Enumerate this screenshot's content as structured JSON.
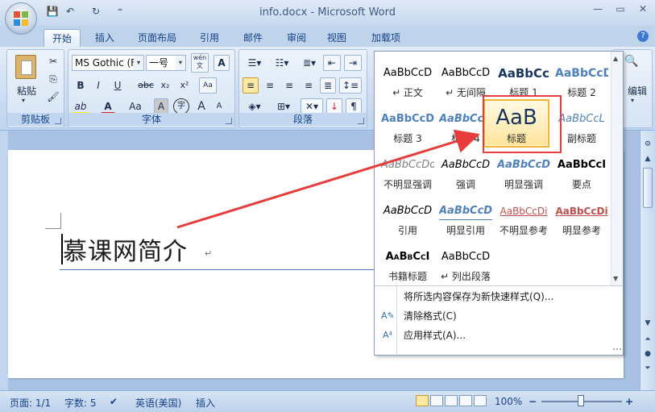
{
  "window": {
    "title": "info.docx - Microsoft Word",
    "controls": {
      "minimize": "—",
      "maximize": "▭",
      "close": "✕"
    }
  },
  "qat": {
    "save": "💾",
    "undo": "↶",
    "redo": "↻",
    "customize": "⁼"
  },
  "tabs": [
    {
      "label": "开始",
      "active": true
    },
    {
      "label": "插入"
    },
    {
      "label": "页面布局"
    },
    {
      "label": "引用"
    },
    {
      "label": "邮件"
    },
    {
      "label": "审阅"
    },
    {
      "label": "视图"
    },
    {
      "label": "加载项"
    }
  ],
  "help": "?",
  "ribbon": {
    "clipboard": {
      "label": "剪贴板",
      "paste": "粘贴"
    },
    "font": {
      "label": "字体",
      "family": "MS Gothic (F",
      "size": "一号",
      "wen": "wén\n文",
      "A_box": "A",
      "bold": "B",
      "italic": "I",
      "underline": "U",
      "strike": "abc",
      "sub": "x₂",
      "sup": "x²",
      "clear": "Aa",
      "highlight": "ab",
      "color": "A",
      "case": "Aa",
      "charshade": "A",
      "enclose": "字",
      "grow": "A",
      "shrink": "A"
    },
    "paragraph": {
      "label": "段落"
    },
    "editing": {
      "label": "编辑"
    }
  },
  "document": {
    "title_text": "慕课网简介",
    "para_mark": "↵"
  },
  "gallery": {
    "items": [
      {
        "sample": "AaBbCcD",
        "name": "↵ 正文"
      },
      {
        "sample": "AaBbCcD",
        "name": "↵ 无间隔"
      },
      {
        "sample": "AaBbCc",
        "name": "标题 1"
      },
      {
        "sample": "AaBbCcD",
        "name": "标题 2"
      },
      {
        "sample": "AaBbCcDc",
        "name": "标题 3"
      },
      {
        "sample": "AaBbCcDd",
        "name": "标题 4"
      },
      {
        "sample": "AaB",
        "name": "标题"
      },
      {
        "sample": "AaBbCcL",
        "name": "副标题"
      },
      {
        "sample": "AaBbCcDd",
        "name": "不明显强调"
      },
      {
        "sample": "AaBbCcD",
        "name": "强调"
      },
      {
        "sample": "AaBbCcD",
        "name": "明显强调"
      },
      {
        "sample": "AaBbCcI",
        "name": "要点"
      },
      {
        "sample": "AaBbCcD",
        "name": "引用"
      },
      {
        "sample": "AaBbCcD",
        "name": "明显引用"
      },
      {
        "sample": "AaBbCcDi",
        "name": "不明显参考"
      },
      {
        "sample": "AaBbCcDi",
        "name": "明显参考"
      },
      {
        "sample": "AaBbCcI",
        "name": "书籍标题"
      },
      {
        "sample": "AaBbCcD",
        "name": "↵ 列出段落"
      }
    ],
    "menu": [
      {
        "label": "将所选内容保存为新快速样式(Q)..."
      },
      {
        "label": "清除格式(C)"
      },
      {
        "label": "应用样式(A)..."
      }
    ]
  },
  "status": {
    "page": "页面: 1/1",
    "words": "字数: 5",
    "language": "英语(美国)",
    "mode": "插入",
    "zoom": "100%",
    "zoom_minus": "−",
    "zoom_plus": "+"
  },
  "colors": {
    "accent": "#15428b",
    "highlight_red": "#e83c3c",
    "selected_gold": "#f2b53a"
  }
}
